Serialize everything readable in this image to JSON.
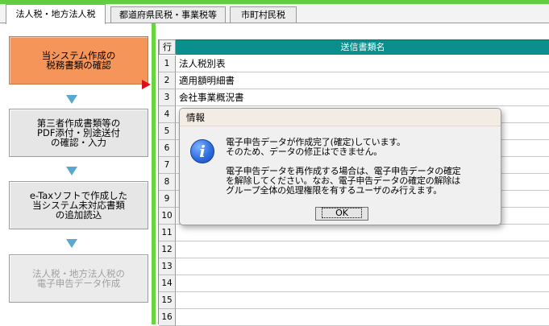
{
  "tabs": [
    {
      "label": "法人税・地方法人税",
      "active": true
    },
    {
      "label": "都道府県民税・事業税等",
      "active": false
    },
    {
      "label": "市町村民税",
      "active": false
    }
  ],
  "steps": [
    {
      "label": "当システム作成の\n税務書類の確認",
      "state": "active"
    },
    {
      "label": "第三者作成書類等の\nPDF添付・別途送付\nの確認・入力",
      "state": "normal"
    },
    {
      "label": "e-Taxソフトで作成した\n当システム未対応書類\nの追加読込",
      "state": "normal"
    },
    {
      "label": "法人税・地方法人税の\n電子申告データ作成",
      "state": "disabled"
    }
  ],
  "grid": {
    "header_row": "行",
    "header_name": "送信書類名",
    "rows": [
      {
        "num": "1",
        "name": "法人税別表"
      },
      {
        "num": "2",
        "name": "適用額明細書"
      },
      {
        "num": "3",
        "name": "会社事業概況書"
      },
      {
        "num": "4",
        "name": ""
      },
      {
        "num": "5",
        "name": ""
      },
      {
        "num": "6",
        "name": ""
      },
      {
        "num": "7",
        "name": ""
      },
      {
        "num": "8",
        "name": ""
      },
      {
        "num": "9",
        "name": ""
      },
      {
        "num": "10",
        "name": ""
      },
      {
        "num": "11",
        "name": ""
      },
      {
        "num": "12",
        "name": ""
      },
      {
        "num": "13",
        "name": ""
      },
      {
        "num": "14",
        "name": ""
      },
      {
        "num": "15",
        "name": ""
      },
      {
        "num": "16",
        "name": ""
      }
    ]
  },
  "dialog": {
    "title": "情報",
    "icon": "info-icon",
    "lines": [
      "電子申告データが作成完了(確定)しています。",
      "そのため、データの修正はできません。",
      "電子申告データを再作成する場合は、電子申告データの確定",
      "を解除してください。なお、電子申告データの確定の解除は",
      "グループ全体の処理権限を有するユーザのみ行えます。"
    ],
    "ok_label": "OK"
  },
  "colors": {
    "accent_green": "#5fcf3f",
    "active_step": "#f6955a",
    "grid_header": "#0a8f8c",
    "arrow_blue": "#58a8d0",
    "arrow_red": "#d81020"
  }
}
